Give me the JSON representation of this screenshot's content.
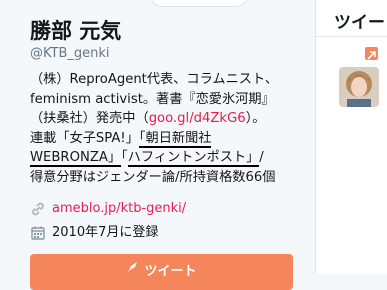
{
  "profile": {
    "display_name": "勝部 元気",
    "screen_name": "@KTB_genki",
    "bio": {
      "l1": "（株）ReproAgent代表、コラムニスト、",
      "l2": "feminism activist。著書『恋愛氷河期』",
      "l3_pre": "（扶桑社）発売中（",
      "l3_link": "goo.gl/d4ZkG6",
      "l3_post": "）。",
      "l4_pre": "連載「女子SPA!」",
      "l4_mark": "「朝日新聞社",
      "l5_mark": "WEBRONZA」",
      "l5_mid": "「",
      "l5_mark2": "ハフィントンポスト」",
      "l5_post": "/",
      "l6": "得意分野はジェンダー論/所持資格数66個"
    },
    "url": "ameblo.jp/ktb-genki/",
    "joined": "2010年7月に登録",
    "url_icon": "link-icon",
    "joined_icon": "calendar-icon"
  },
  "tweet_button": {
    "label": "ツイート",
    "icon": "quill-icon"
  },
  "right_panel": {
    "header": "ツイー",
    "promo_icon": "promoted-icon"
  },
  "colors": {
    "accent": "#e81c4f",
    "button": "#f5865c",
    "text": "#14171a",
    "secondary": "#657786"
  }
}
